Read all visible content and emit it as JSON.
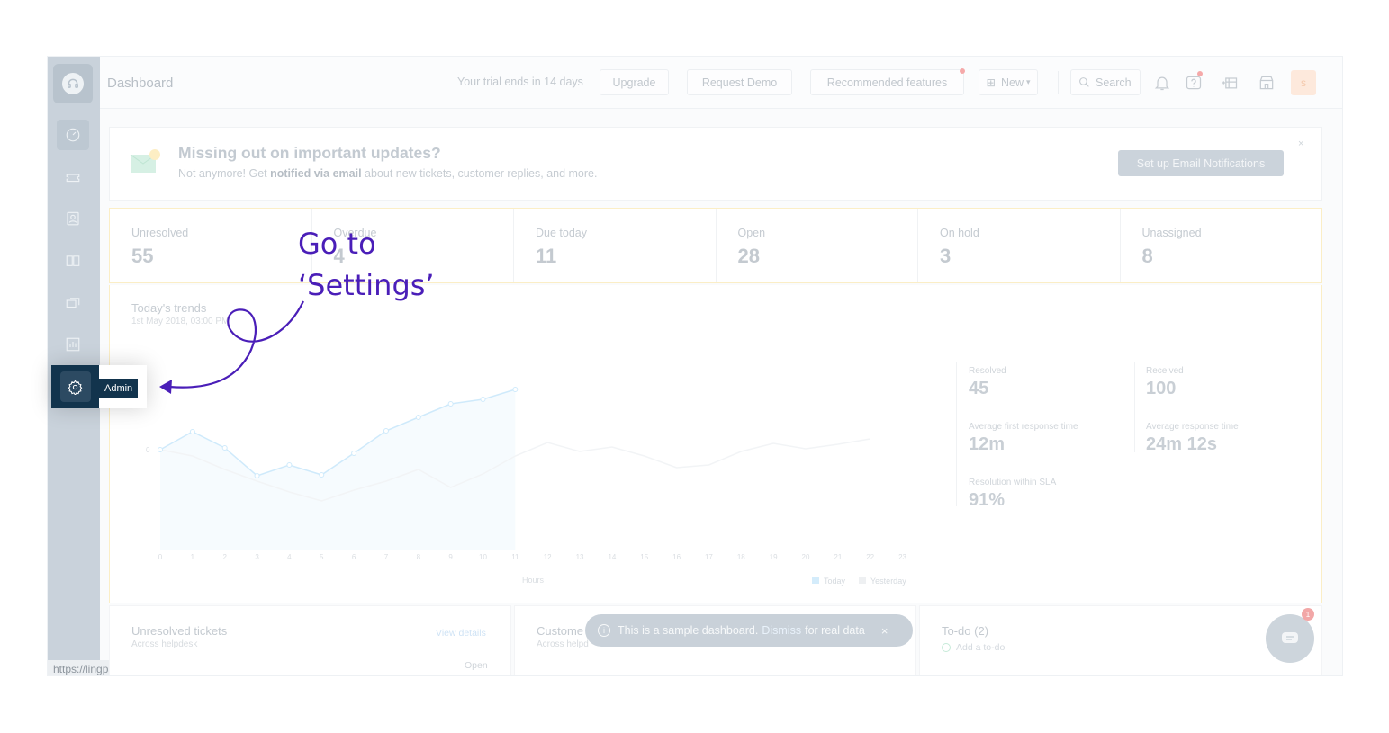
{
  "sidebar": {
    "logo_icon": "headset-icon",
    "items": [
      {
        "name": "dashboard",
        "icon": "dashboard-icon"
      },
      {
        "name": "tickets",
        "icon": "ticket-icon"
      },
      {
        "name": "contacts",
        "icon": "contact-icon"
      },
      {
        "name": "solutions",
        "icon": "book-icon"
      },
      {
        "name": "forums",
        "icon": "forum-icon"
      },
      {
        "name": "reports",
        "icon": "report-icon"
      },
      {
        "name": "admin",
        "icon": "gear-icon",
        "tooltip": "Admin"
      }
    ]
  },
  "header": {
    "title": "Dashboard",
    "trial_text": "Your trial ends in 14 days",
    "upgrade_label": "Upgrade",
    "request_demo_label": "Request Demo",
    "recommended_label": "Recommended features",
    "new_label": "New",
    "search_placeholder": "Search",
    "avatar_letter": "s"
  },
  "banner": {
    "title": "Missing out on important updates?",
    "text_prefix": "Not anymore! Get ",
    "text_bold": "notified via email",
    "text_suffix": " about new tickets, customer replies, and more.",
    "button_label": "Set up Email Notifications",
    "close": "×"
  },
  "stats": [
    {
      "label": "Unresolved",
      "value": "55"
    },
    {
      "label": "Overdue",
      "value": "4"
    },
    {
      "label": "Due today",
      "value": "11"
    },
    {
      "label": "Open",
      "value": "28"
    },
    {
      "label": "On hold",
      "value": "3"
    },
    {
      "label": "Unassigned",
      "value": "8"
    }
  ],
  "trends": {
    "title": "Today's trends",
    "subtitle": "1st May 2018, 03:00 PM",
    "xlabel": "Hours",
    "y_tick": "0",
    "x_ticks": [
      "0",
      "1",
      "2",
      "3",
      "4",
      "5",
      "6",
      "7",
      "8",
      "9",
      "10",
      "11",
      "12",
      "13",
      "14",
      "15",
      "16",
      "17",
      "18",
      "19",
      "20",
      "21",
      "22",
      "23"
    ],
    "legend_today": "Today",
    "legend_yesterday": "Yesterday",
    "metrics": [
      {
        "label": "Resolved",
        "value": "45"
      },
      {
        "label": "Received",
        "value": "100"
      },
      {
        "label": "Average first response time",
        "value": "12m"
      },
      {
        "label": "Average response time",
        "value": "24m 12s"
      },
      {
        "label": "Resolution within SLA",
        "value": "91%"
      }
    ]
  },
  "bottom": {
    "unresolved_title": "Unresolved tickets",
    "unresolved_sub": "Across helpdesk",
    "view_details": "View details",
    "open_label": "Open",
    "customer_title": "Custome",
    "customer_sub": "Across helpd",
    "todo_title": "To-do (2)",
    "todo_add": "Add a to-do"
  },
  "toast": {
    "text": "This is a sample dashboard.",
    "dismiss": "Dismiss",
    "suffix": "for real data",
    "close": "×"
  },
  "chat_badge": "1",
  "status_url": "https://lingpad2067.freshdesk.com/a/admin",
  "annotation": {
    "line1": "Go to",
    "line2": "‘Settings’"
  },
  "colors": {
    "annotation": "#4a1eb8",
    "admin_bg": "#12344d",
    "today_series": "#a9d8f5"
  }
}
